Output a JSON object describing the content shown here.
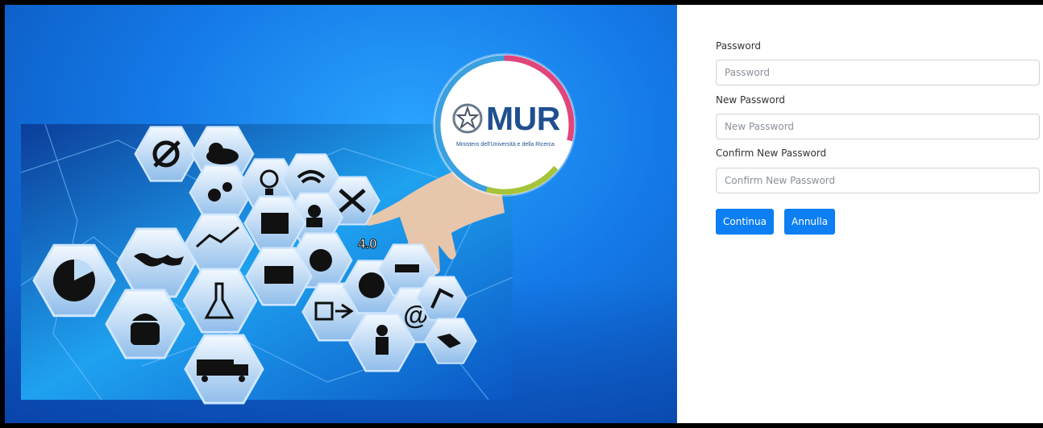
{
  "logo": {
    "name": "MUR",
    "subtitle": "Ministero dell'Università e della Ricerca"
  },
  "hero": {
    "badge_text": "4.0"
  },
  "form": {
    "password": {
      "label": "Password",
      "placeholder": "Password",
      "value": ""
    },
    "new_password": {
      "label": "New Password",
      "placeholder": "New Password",
      "value": ""
    },
    "confirm_password": {
      "label": "Confirm New Password",
      "placeholder": "Confirm New Password",
      "value": ""
    },
    "continue_label": "Continua",
    "cancel_label": "Annulla"
  },
  "colors": {
    "primary": "#0d7ff2",
    "hero_blue": "#1479e6",
    "logo_blue": "#1f4f8f",
    "ring_pink": "#e0457b",
    "ring_green": "#a6c43a",
    "ring_blue": "#3aa0e0"
  },
  "icons": [
    "no-signal-icon",
    "cloud-icon",
    "gears-icon",
    "lightbulb-icon",
    "wifi-icon",
    "tools-icon",
    "pie-chart-icon",
    "world-map-icon",
    "chip-icon",
    "worker-icon",
    "flask-icon",
    "brain-icon",
    "plug-icon",
    "at-icon",
    "truck-icon",
    "robot-arm-icon",
    "handshake-icon"
  ]
}
